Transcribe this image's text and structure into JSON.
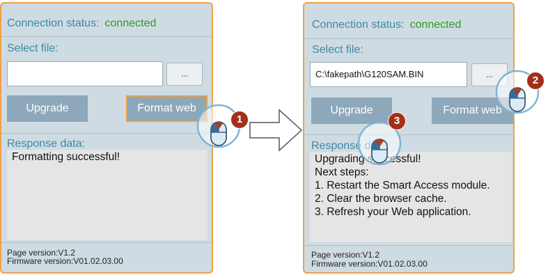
{
  "left": {
    "status_label": "Connection status:",
    "status_value": "connected",
    "select_file_label": "Select file:",
    "file_value": "",
    "browse_label": "...",
    "upgrade_label": "Upgrade",
    "format_label": "Format web",
    "response_label": "Response data:",
    "response_lines": [
      "Formatting successful!"
    ],
    "page_version": "Page version:V1.2",
    "firmware_version": "Firmware version:V01.02.03.00"
  },
  "right": {
    "status_label": "Connection status:",
    "status_value": "connected",
    "select_file_label": "Select file:",
    "file_value": "C:\\fakepath\\G120SAM.BIN",
    "browse_label": "...",
    "upgrade_label": "Upgrade",
    "format_label": "Format web",
    "response_label": "Response data:",
    "response_lines": [
      "Upgrading successful!",
      "Next steps:",
      "1. Restart the Smart Access module.",
      "2. Clear the browser cache.",
      "3. Refresh your Web application."
    ],
    "page_version": "Page version:V1.2",
    "firmware_version": "Firmware version:V01.02.03.00"
  },
  "steps": [
    "1",
    "2",
    "3"
  ],
  "colors": {
    "accent": "#f0a048",
    "status_ok": "#2d9b23",
    "label": "#3c8aa6",
    "button": "#8da7bb",
    "badge": "#a42f1b"
  },
  "icons": [
    "mouse-click-icon",
    "right-arrow-icon"
  ]
}
